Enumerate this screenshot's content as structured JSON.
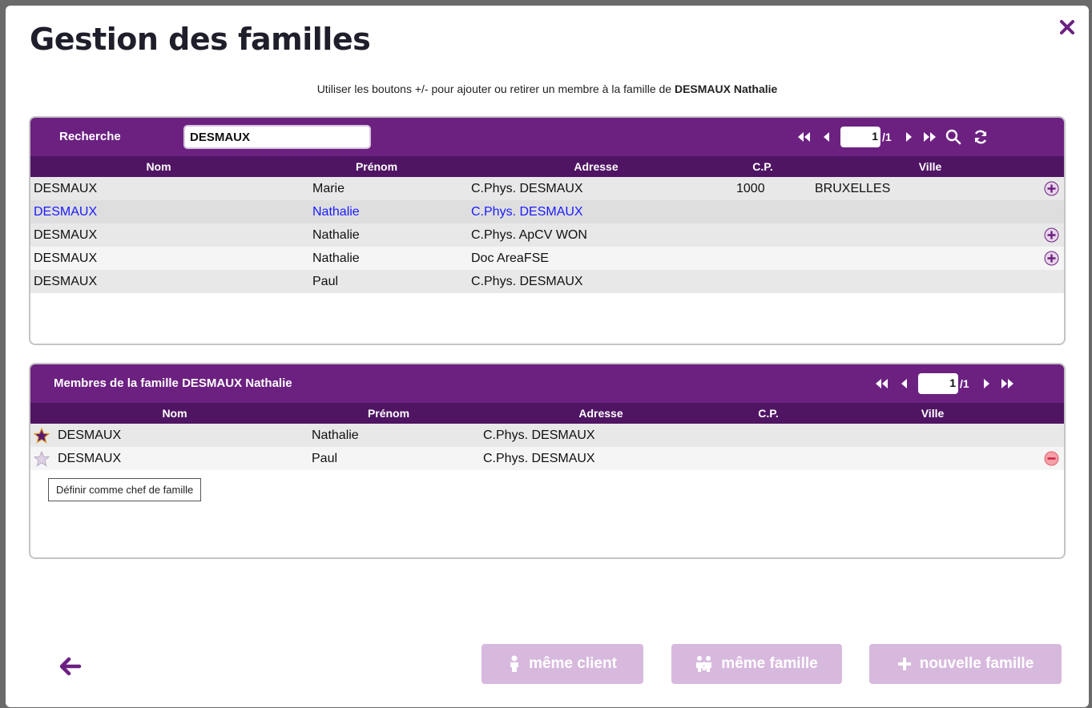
{
  "title": "Gestion des familles",
  "instruction": {
    "prefix": "Utiliser les boutons +/- pour ajouter ou retirer un membre à la famille de",
    "name": "DESMAUX Nathalie"
  },
  "search": {
    "label": "Recherche",
    "value": "DESMAUX",
    "page": "1",
    "total": "/1",
    "columns": [
      "Nom",
      "Prénom",
      "Adresse",
      "C.P.",
      "Ville"
    ],
    "rows": [
      {
        "nom": "DESMAUX",
        "prenom": "Marie",
        "adresse": "C.Phys. DESMAUX",
        "cp": "1000",
        "ville": "BRUXELLES",
        "action": "plus"
      },
      {
        "nom": "DESMAUX",
        "prenom": "Nathalie",
        "adresse": "C.Phys. DESMAUX",
        "cp": "",
        "ville": "",
        "action": "",
        "selected": true
      },
      {
        "nom": "DESMAUX",
        "prenom": "Nathalie",
        "adresse": "C.Phys. ApCV WON",
        "cp": "",
        "ville": "",
        "action": "plus"
      },
      {
        "nom": "DESMAUX",
        "prenom": "Nathalie",
        "adresse": "Doc AreaFSE",
        "cp": "",
        "ville": "",
        "action": "plus"
      },
      {
        "nom": "DESMAUX",
        "prenom": "Paul",
        "adresse": "C.Phys. DESMAUX",
        "cp": "",
        "ville": "",
        "action": ""
      }
    ]
  },
  "members": {
    "label": "Membres de la famille DESMAUX Nathalie",
    "page": "1",
    "total": "/1",
    "columns": [
      "Nom",
      "Prénom",
      "Adresse",
      "C.P.",
      "Ville"
    ],
    "rows": [
      {
        "nom": "DESMAUX",
        "prenom": "Nathalie",
        "adresse": "C.Phys. DESMAUX",
        "cp": "",
        "ville": "",
        "chef": true,
        "action": ""
      },
      {
        "nom": "DESMAUX",
        "prenom": "Paul",
        "adresse": "C.Phys. DESMAUX",
        "cp": "",
        "ville": "",
        "chef": false,
        "action": "minus"
      }
    ],
    "tooltip": "Définir comme chef de famille"
  },
  "buttons": {
    "meme_client": "même client",
    "meme_famille": "même famille",
    "nouvelle_famille": "nouvelle famille"
  },
  "colors": {
    "header": "#6c2181",
    "column_header": "#4f1563",
    "accent": "#6c2181",
    "button_disabled": "#d8b9de",
    "selected_text": "#1a1aff",
    "minus": "#f4a0a8"
  },
  "icons": [
    "close-icon",
    "first-page-icon",
    "prev-page-icon",
    "next-page-icon",
    "last-page-icon",
    "search-icon",
    "refresh-icon",
    "plus-circle-icon",
    "minus-circle-icon",
    "star-icon",
    "back-arrow-icon",
    "person-icon",
    "family-icon",
    "plus-icon"
  ]
}
